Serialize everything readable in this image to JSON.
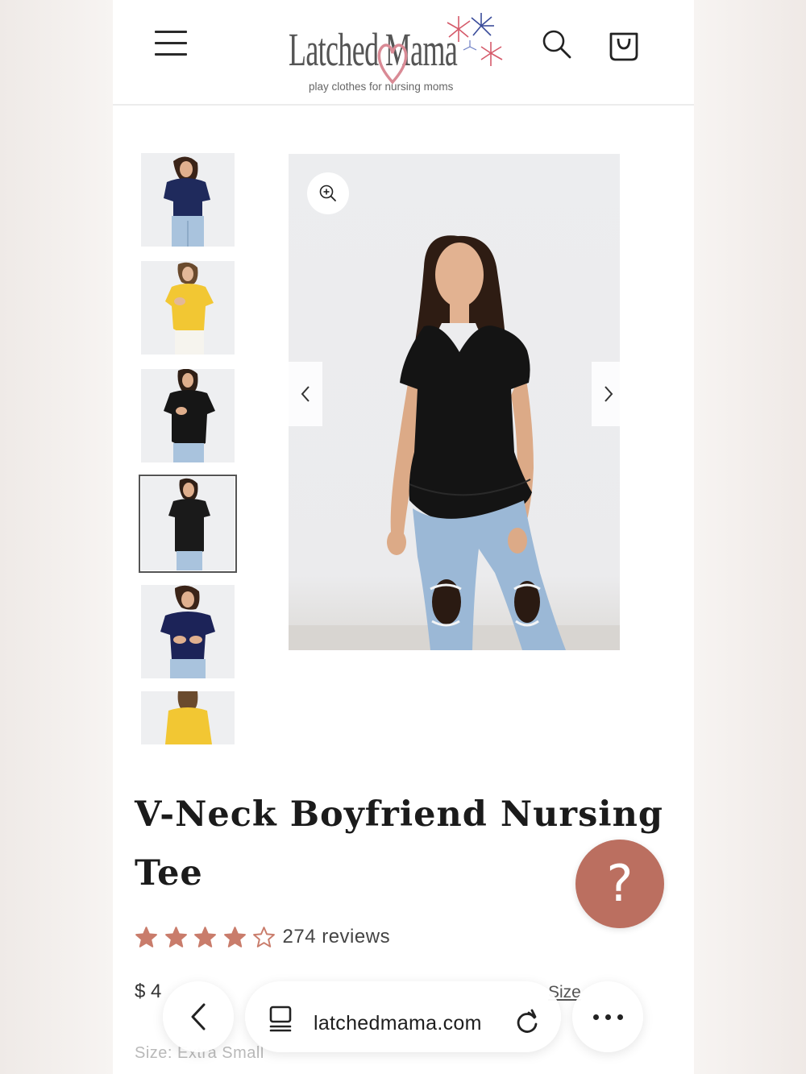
{
  "header": {
    "logo_text": "Latched Mama",
    "logo_tagline": "play clothes for nursing moms",
    "menu_icon": "hamburger-menu-icon",
    "search_icon": "search-icon",
    "cart_icon": "cart-bag-icon"
  },
  "gallery": {
    "thumbnails": [
      {
        "shirt_color": "#1f2a5c",
        "pose": "standing"
      },
      {
        "shirt_color": "#f2c733",
        "pose": "nursing-access"
      },
      {
        "shirt_color": "#161616",
        "pose": "nursing-access"
      },
      {
        "shirt_color": "#1a1a1a",
        "pose": "standing",
        "selected": true
      },
      {
        "shirt_color": "#1c2358",
        "pose": "nursing-access"
      },
      {
        "shirt_color": "#f2c733",
        "pose": "back"
      }
    ],
    "zoom_icon": "zoom-in-icon",
    "prev_icon": "chevron-left-icon",
    "next_icon": "chevron-right-icon",
    "main_shirt_color": "#141414"
  },
  "product": {
    "title": "V-Neck Boyfriend Nursing Tee",
    "rating": 4,
    "max_rating": 5,
    "reviews_label": "274 reviews",
    "price_partial": "$ 4",
    "size_link_partial": "Size",
    "size_label": "Size: Extra Small"
  },
  "help_button": {
    "label": "?"
  },
  "browser": {
    "url": "latchedmama.com",
    "back_icon": "chevron-left-icon",
    "tabs_icon": "tabs-icon",
    "reload_icon": "reload-icon",
    "more_icon": "more-dots-icon"
  },
  "colors": {
    "accent": "#bb6f60",
    "star": "#c97c6b",
    "logo_heart": "#d98a95"
  }
}
